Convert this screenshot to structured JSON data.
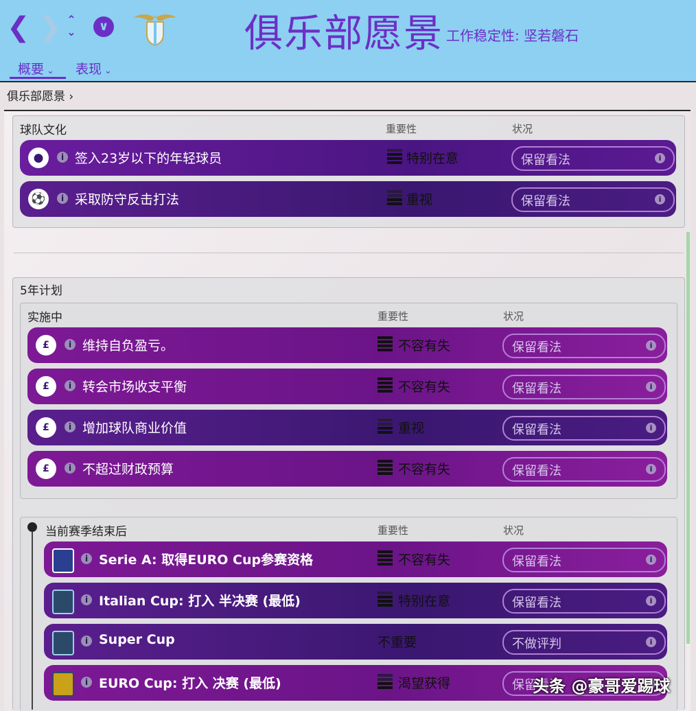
{
  "header": {
    "title": "俱乐部愿景",
    "stability_label": "工作稳定性: 坚若磐石",
    "crest_text": "S.S.LAZIO",
    "colors": {
      "accent": "#6b2fc6",
      "topbar": "#8dd0f2"
    }
  },
  "tabs": [
    {
      "label": "概要"
    },
    {
      "label": "表现"
    }
  ],
  "breadcrumb": "俱乐部愿景",
  "columns": {
    "importance": "重要性",
    "status": "状况"
  },
  "culture": {
    "title": "球队文化",
    "rows": [
      {
        "icon": "person-icon",
        "label": "签入23岁以下的年轻球员",
        "importance": "特别在意",
        "status": "保留看法"
      },
      {
        "icon": "football-icon",
        "label": "采取防守反击打法",
        "importance": "重视",
        "status": "保留看法"
      }
    ]
  },
  "plan": {
    "title": "5年计划",
    "ongoing": {
      "title": "实施中",
      "rows": [
        {
          "icon": "money-icon",
          "label": "维持自负盈亏。",
          "importance": "不容有失",
          "status": "保留看法"
        },
        {
          "icon": "money-icon",
          "label": "转会市场收支平衡",
          "importance": "不容有失",
          "status": "保留看法"
        },
        {
          "icon": "money-icon",
          "label": "增加球队商业价值",
          "importance": "重视",
          "status": "保留看法"
        },
        {
          "icon": "money-icon",
          "label": "不超过财政预算",
          "importance": "不容有失",
          "status": "保留看法"
        }
      ]
    },
    "season_end": {
      "title": "当前赛季结束后",
      "rows": [
        {
          "icon": "serie-a-icon",
          "label": "Serie A: 取得EURO Cup参赛资格",
          "importance": "不容有失",
          "status": "保留看法"
        },
        {
          "icon": "italian-cup-icon",
          "label": "Italian Cup: 打入 半决赛 (最低)",
          "importance": "特别在意",
          "status": "保留看法"
        },
        {
          "icon": "super-cup-icon",
          "label": "Super Cup",
          "importance": "不重要",
          "status": "不做评判"
        },
        {
          "icon": "euro-cup-icon",
          "label": "EURO Cup: 打入 决赛 (最低)",
          "importance": "渴望获得",
          "status": "保留看法"
        }
      ]
    }
  },
  "watermark": "头条 @豪哥爱踢球"
}
